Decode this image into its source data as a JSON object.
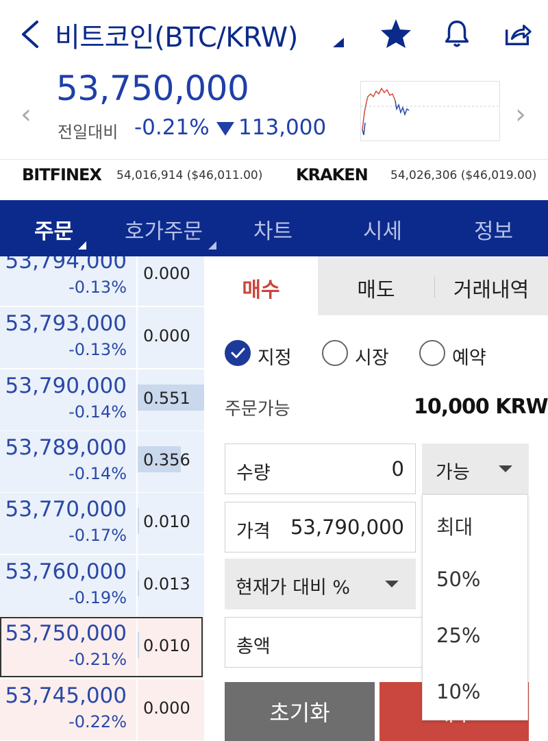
{
  "header": {
    "title": "비트코인(BTC/KRW)",
    "price": "53,750,000",
    "change_label": "전일대비",
    "change_pct": "-0.21%",
    "change_amount": "113,000"
  },
  "exchanges": [
    {
      "name": "BITFINEX",
      "value": "54,016,914 ($46,011.00)"
    },
    {
      "name": "KRAKEN",
      "value": "54,026,306 ($46,019.00)"
    }
  ],
  "tabs": [
    {
      "label": "주문",
      "active": true
    },
    {
      "label": "호가주문",
      "active": false
    },
    {
      "label": "차트",
      "active": false
    },
    {
      "label": "시세",
      "active": false
    },
    {
      "label": "정보",
      "active": false
    }
  ],
  "orderbook": [
    {
      "price": "53,794,000",
      "pct": "-0.13%",
      "volume": "0.000",
      "bar": 0,
      "side": "ask"
    },
    {
      "price": "53,793,000",
      "pct": "-0.13%",
      "volume": "0.000",
      "bar": 0,
      "side": "ask"
    },
    {
      "price": "53,790,000",
      "pct": "-0.14%",
      "volume": "0.551",
      "bar": 1.0,
      "side": "ask"
    },
    {
      "price": "53,789,000",
      "pct": "-0.14%",
      "volume": "0.356",
      "bar": 0.65,
      "side": "ask"
    },
    {
      "price": "53,770,000",
      "pct": "-0.17%",
      "volume": "0.010",
      "bar": 0.02,
      "side": "ask"
    },
    {
      "price": "53,760,000",
      "pct": "-0.19%",
      "volume": "0.013",
      "bar": 0.02,
      "side": "ask"
    },
    {
      "price": "53,750,000",
      "pct": "-0.21%",
      "volume": "0.010",
      "bar": 0.02,
      "side": "bid",
      "current": true
    },
    {
      "price": "53,745,000",
      "pct": "-0.22%",
      "volume": "0.000",
      "bar": 0,
      "side": "bid"
    }
  ],
  "order_tabs": {
    "buy": "매수",
    "sell": "매도",
    "history": "거래내역"
  },
  "order_types": {
    "limit": "지정",
    "market": "시장",
    "reserve": "예약"
  },
  "available": {
    "label": "주문가능",
    "value": "10,000 KRW"
  },
  "quantity": {
    "label": "수량",
    "value": "0"
  },
  "price_input": {
    "label": "가격",
    "value": "53,790,000"
  },
  "pct_select": {
    "label": "현재가 대비 %"
  },
  "total": {
    "label": "총액"
  },
  "avail_select": {
    "label": "가능",
    "options": [
      "최대",
      "50%",
      "25%",
      "10%"
    ]
  },
  "buttons": {
    "reset": "초기화",
    "buy": "매수"
  },
  "colors": {
    "brand": "#0c2a8c",
    "down": "#1f3fa8",
    "buy": "#c9473e",
    "ask_bg": "#eaf1fa",
    "bid_bg": "#fbeeed"
  }
}
